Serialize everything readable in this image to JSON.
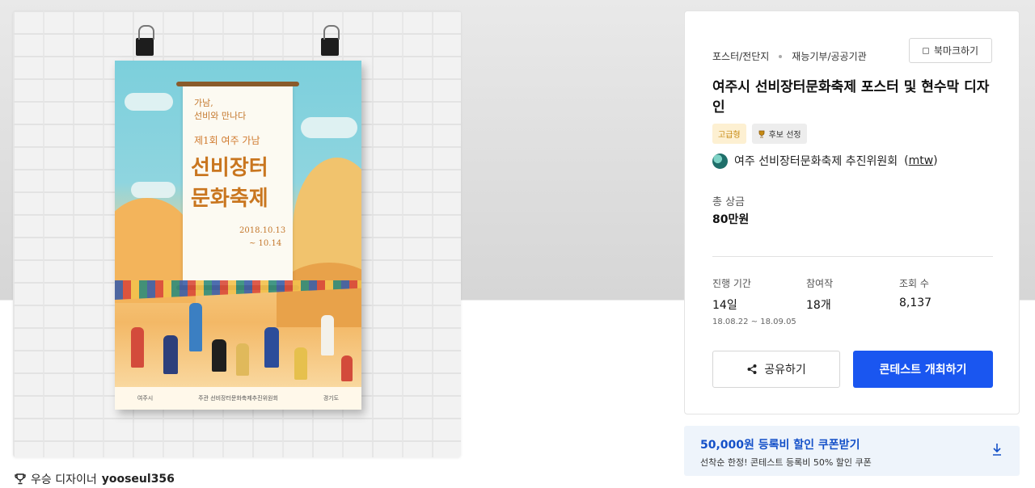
{
  "poster": {
    "subtitle1": "가남,",
    "subtitle2": "선비와 만나다",
    "heading_small": "제1회 여주 가남",
    "heading_line1": "선비장터",
    "heading_line2": "문화축제",
    "date_line1": "2018.10.13",
    "date_line2": "~ 10.14",
    "footer_left": "여주시",
    "footer_mid": "주관 선비장터문화축제추진위원회",
    "footer_right": "경기도"
  },
  "winner": {
    "label": "우승 디자이너",
    "name": "yooseul356"
  },
  "breadcrumb": {
    "category": "포스터/전단지",
    "type": "재능기부/공공기관"
  },
  "bookmark_label": "북마크하기",
  "contest_title": "여주시 선비장터문화축제 포스터 및 현수막 디자인",
  "badges": {
    "grade": "고급형",
    "selected": "후보 선정"
  },
  "host": {
    "name": "여주 선비장터문화축제 추진위원회",
    "id_open": "(",
    "id": "mtw",
    "id_close": ")"
  },
  "prize": {
    "label": "총 상금",
    "value": "80만원"
  },
  "stats": {
    "period_label": "진행 기간",
    "period_value": "14일",
    "period_range": "18.08.22 ~ 18.09.05",
    "entries_label": "참여작",
    "entries_value": "18개",
    "views_label": "조회 수",
    "views_value": "8,137"
  },
  "buttons": {
    "share": "공유하기",
    "host_contest": "콘테스트 개최하기"
  },
  "coupon": {
    "title": "50,000원 등록비 할인 쿠폰받기",
    "desc": "선착순 한정! 콘테스트 등록비 50% 할인 쿠폰"
  },
  "colors": {
    "primary": "#1a56f0",
    "coupon_bg": "#eef4fb",
    "coupon_text": "#1450c8",
    "grade_badge_bg": "#fdf0d2"
  }
}
